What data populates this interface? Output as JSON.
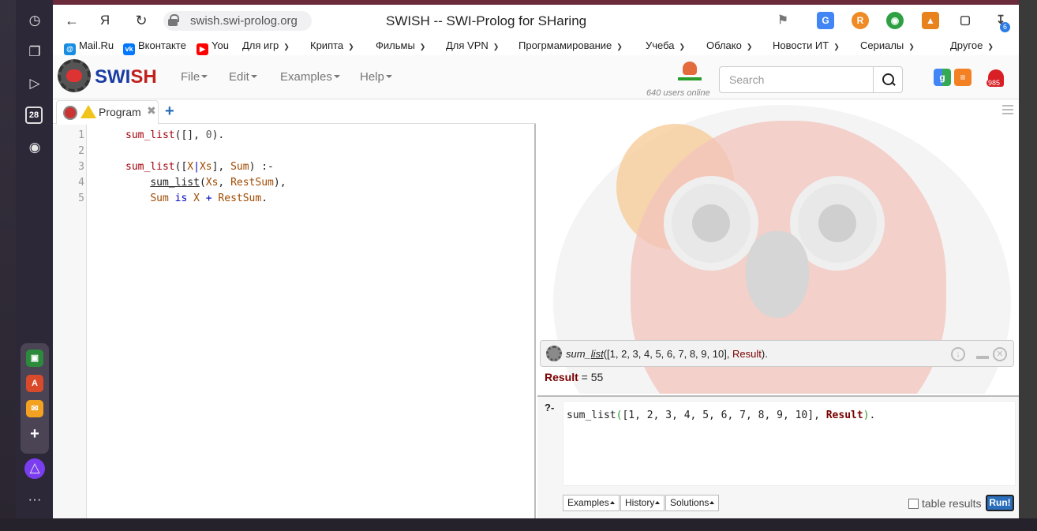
{
  "browser": {
    "url": "swish.swi-prolog.org",
    "title": "SWISH -- SWI-Prolog for SHaring",
    "download_badge": "6",
    "yandex_label": "Я"
  },
  "bookmarks": [
    {
      "label": "Mail.Ru",
      "icon": "mailru-icon"
    },
    {
      "label": "Вконтакте",
      "icon": "vk-icon"
    },
    {
      "label": "You",
      "icon": "youtube-icon"
    },
    {
      "label": "Для игр",
      "folder": true
    },
    {
      "label": "Крипта",
      "folder": true
    },
    {
      "label": "Фильмы",
      "folder": true
    },
    {
      "label": "Для VPN",
      "folder": true
    },
    {
      "label": "Прогрмамирование",
      "folder": true
    },
    {
      "label": "Учеба",
      "folder": true
    },
    {
      "label": "Облако",
      "folder": true
    },
    {
      "label": "Новости ИТ",
      "folder": true
    },
    {
      "label": "Сериалы",
      "folder": true
    },
    {
      "label": "Другое",
      "folder": true
    }
  ],
  "sidebar": {
    "calendar_day": "28"
  },
  "swish": {
    "brand_sw": "SWI",
    "brand_sh": "SH",
    "menu": [
      "File",
      "Edit",
      "Examples",
      "Help"
    ],
    "users_online": "640 users online",
    "search_placeholder": "Search",
    "notification_count": "985"
  },
  "editor": {
    "tab_label": "Program",
    "line_numbers": [
      "1",
      "2",
      "3",
      "4",
      "5"
    ]
  },
  "answer": {
    "query": "sum_list([1, 2, 3, 4, 5, 6, 7, 8, 9, 10], Result).",
    "result_var": "Result",
    "result_value": " = 55"
  },
  "query_editor": {
    "prompt": "?-",
    "text": "sum_list([1, 2, 3, 4, 5, 6, 7, 8, 9, 10], Result).",
    "buttons": [
      "Examples",
      "History",
      "Solutions"
    ],
    "table_results_label": "table results",
    "run_label": "Run!"
  },
  "colors": {
    "brand_blue": "#1a3da3",
    "brand_red": "#c0201e",
    "run_button": "#2a6ebb"
  }
}
